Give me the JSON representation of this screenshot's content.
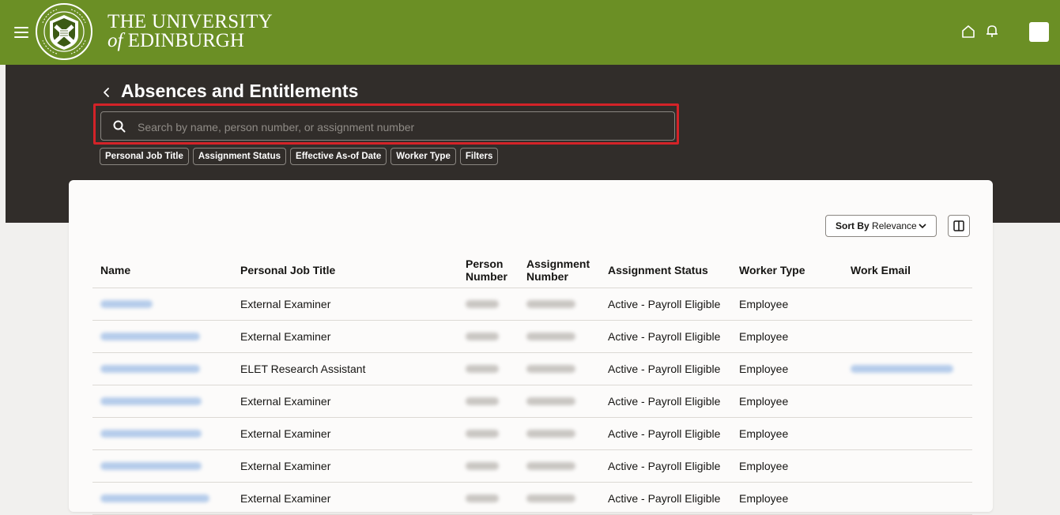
{
  "header": {
    "university_line1": "THE UNIVERSITY",
    "university_line2_prefix": "of",
    "university_line2": "EDINBURGH",
    "brand_color": "#6b8f25"
  },
  "page": {
    "title": "Absences and Entitlements"
  },
  "search": {
    "placeholder": "Search by name, person number, or assignment number",
    "value": ""
  },
  "filter_chips": [
    "Personal Job Title",
    "Assignment Status",
    "Effective As-of Date",
    "Worker Type",
    "Filters"
  ],
  "sort": {
    "prefix": "Sort By",
    "value": "Relevance"
  },
  "table": {
    "columns": [
      "Name",
      "Personal Job Title",
      "Person Number",
      "Assignment Number",
      "Assignment Status",
      "Worker Type",
      "Work Email"
    ],
    "rows": [
      {
        "job_title": "External Examiner",
        "status": "Active - Payroll Eligible",
        "worker_type": "Employee"
      },
      {
        "job_title": "External Examiner",
        "status": "Active - Payroll Eligible",
        "worker_type": "Employee"
      },
      {
        "job_title": "ELET Research Assistant",
        "status": "Active - Payroll Eligible",
        "worker_type": "Employee"
      },
      {
        "job_title": "External Examiner",
        "status": "Active - Payroll Eligible",
        "worker_type": "Employee"
      },
      {
        "job_title": "External Examiner",
        "status": "Active - Payroll Eligible",
        "worker_type": "Employee"
      },
      {
        "job_title": "External Examiner",
        "status": "Active - Payroll Eligible",
        "worker_type": "Employee"
      },
      {
        "job_title": "External Examiner",
        "status": "Active - Payroll Eligible",
        "worker_type": "Employee"
      }
    ]
  }
}
